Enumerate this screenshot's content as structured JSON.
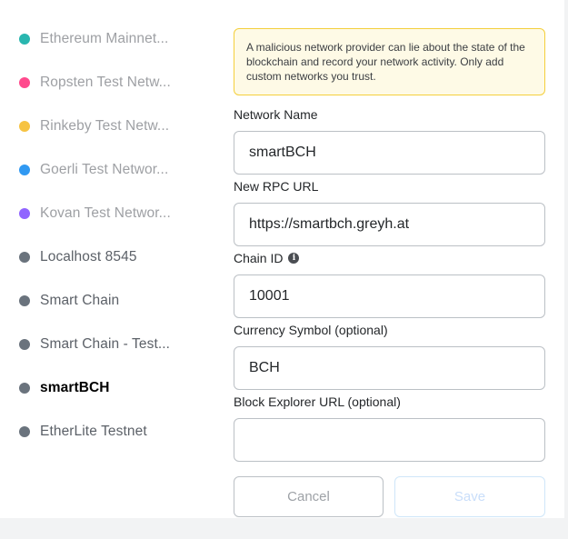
{
  "networks": [
    {
      "label": "Ethereum Mainnet...",
      "color": "#29b6af",
      "state": "faded"
    },
    {
      "label": "Ropsten Test Netw...",
      "color": "#ff4a8d",
      "state": "faded"
    },
    {
      "label": "Rinkeby Test Netw...",
      "color": "#f6c343",
      "state": "faded"
    },
    {
      "label": "Goerli Test Networ...",
      "color": "#3099f2",
      "state": "faded"
    },
    {
      "label": "Kovan Test Networ...",
      "color": "#9064ff",
      "state": "faded"
    },
    {
      "label": "Localhost 8545",
      "color": "#6a737d",
      "state": "normal"
    },
    {
      "label": "Smart Chain",
      "color": "#6a737d",
      "state": "normal"
    },
    {
      "label": "Smart Chain - Test...",
      "color": "#6a737d",
      "state": "normal"
    },
    {
      "label": "smartBCH",
      "color": "#6a737d",
      "state": "selected"
    },
    {
      "label": "EtherLite Testnet",
      "color": "#6a737d",
      "state": "normal"
    }
  ],
  "warning": {
    "text": "A malicious network provider can lie about the state of the blockchain and record your network activity. Only add custom networks you trust."
  },
  "form": {
    "network_name": {
      "label": "Network Name",
      "value": "smartBCH"
    },
    "rpc_url": {
      "label": "New RPC URL",
      "value": "https://smartbch.greyh.at"
    },
    "chain_id": {
      "label": "Chain ID",
      "value": "10001",
      "info_icon": "info-icon"
    },
    "currency_symbol": {
      "label": "Currency Symbol (optional)",
      "value": "BCH"
    },
    "block_explorer": {
      "label": "Block Explorer URL (optional)",
      "value": ""
    }
  },
  "buttons": {
    "cancel": "Cancel",
    "save": "Save"
  }
}
